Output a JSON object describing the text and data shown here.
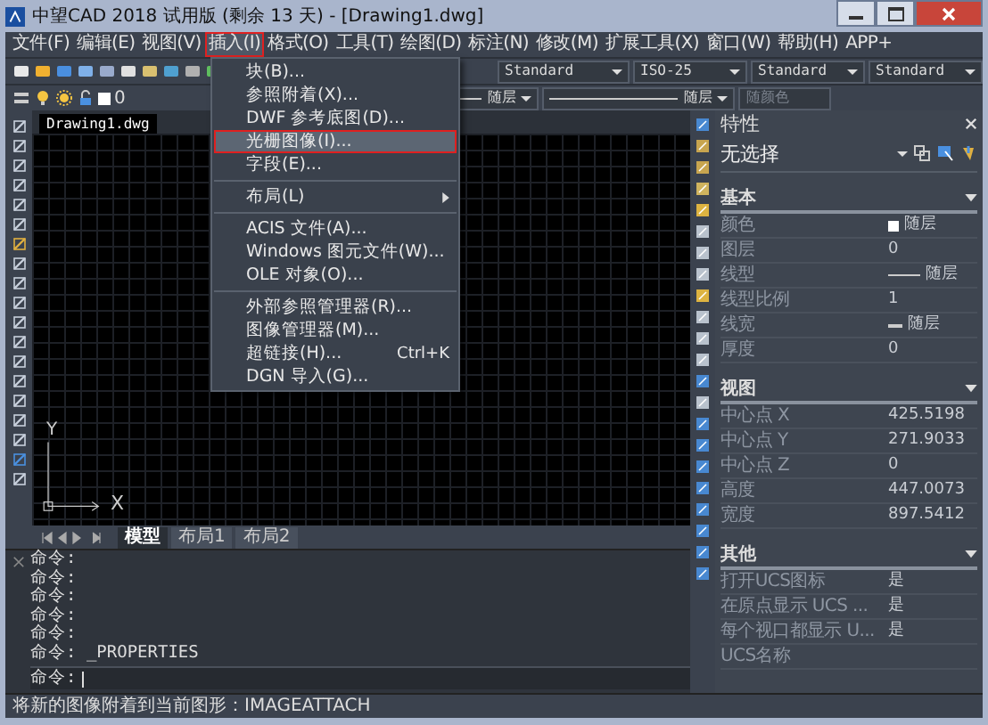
{
  "window": {
    "title": "中望CAD 2018 试用版 (剩余 13 天) - [Drawing1.dwg]"
  },
  "menu_bar": [
    {
      "label": "文件(F)",
      "selected": false
    },
    {
      "label": "编辑(E)",
      "selected": false
    },
    {
      "label": "视图(V)",
      "selected": false
    },
    {
      "label": "插入(I)",
      "selected": true
    },
    {
      "label": "格式(O)",
      "selected": false
    },
    {
      "label": "工具(T)",
      "selected": false
    },
    {
      "label": "绘图(D)",
      "selected": false
    },
    {
      "label": "标注(N)",
      "selected": false
    },
    {
      "label": "修改(M)",
      "selected": false
    },
    {
      "label": "扩展工具(X)",
      "selected": false
    },
    {
      "label": "窗口(W)",
      "selected": false
    },
    {
      "label": "帮助(H)",
      "selected": false
    },
    {
      "label": "APP+",
      "selected": false
    }
  ],
  "insert_menu": [
    {
      "label": "块(B)...",
      "selected": false,
      "submenu": false,
      "divider_after": false
    },
    {
      "label": "参照附着(X)...",
      "selected": false,
      "submenu": false,
      "divider_after": false
    },
    {
      "label": "DWF 参考底图(D)...",
      "selected": false,
      "submenu": false,
      "divider_after": false
    },
    {
      "label": "光栅图像(I)...",
      "selected": true,
      "submenu": false,
      "divider_after": false
    },
    {
      "label": "字段(E)...",
      "selected": false,
      "submenu": false,
      "divider_after": true
    },
    {
      "label": "布局(L)",
      "selected": false,
      "submenu": true,
      "divider_after": true
    },
    {
      "label": "ACIS 文件(A)...",
      "selected": false,
      "submenu": false,
      "divider_after": false
    },
    {
      "label": "Windows 图元文件(W)...",
      "selected": false,
      "submenu": false,
      "divider_after": false
    },
    {
      "label": "OLE 对象(O)...",
      "selected": false,
      "submenu": false,
      "divider_after": true
    },
    {
      "label": "外部参照管理器(R)...",
      "selected": false,
      "submenu": false,
      "divider_after": false
    },
    {
      "label": "图像管理器(M)...",
      "selected": false,
      "submenu": false,
      "divider_after": false
    },
    {
      "label": "超链接(H)...",
      "shortcut": "Ctrl+K",
      "selected": false,
      "submenu": false,
      "divider_after": false
    },
    {
      "label": "DGN 导入(G)...",
      "selected": false,
      "submenu": false,
      "divider_after": false
    }
  ],
  "toolbar": {
    "text_style": "Standard",
    "dim_style": "ISO-25",
    "table_style": "Standard",
    "multileader_style": "Standard",
    "layer": "0",
    "linetype": "随层",
    "lineweight": "随层",
    "plot_style": {
      "value": "随颜色",
      "disabled": true
    }
  },
  "document_tabs": [
    {
      "label": "Drawing1.dwg",
      "selected": true
    }
  ],
  "ucs": {
    "x": "X",
    "y": "Y"
  },
  "layout_tabs": [
    {
      "label": "模型",
      "selected": true
    },
    {
      "label": "布局1",
      "selected": false
    },
    {
      "label": "布局2",
      "selected": false
    }
  ],
  "command": {
    "history": [
      "命令:",
      "命令:",
      "命令:",
      "命令:",
      "命令:",
      "命令: _PROPERTIES"
    ],
    "prompt": "命令:"
  },
  "status_bar": {
    "text": "将新的图像附着到当前图形：IMAGEATTACH"
  },
  "properties": {
    "title": "特性",
    "selection": "无选择",
    "sections": [
      {
        "title": "基本",
        "expanded": true,
        "rows": [
          {
            "label": "颜色",
            "value": "随层",
            "kind": "color"
          },
          {
            "label": "图层",
            "value": "0",
            "kind": "text"
          },
          {
            "label": "线型",
            "value": "随层",
            "kind": "line"
          },
          {
            "label": "线型比例",
            "value": "1",
            "kind": "text"
          },
          {
            "label": "线宽",
            "value": "随层",
            "kind": "weight"
          },
          {
            "label": "厚度",
            "value": "0",
            "kind": "text"
          }
        ]
      },
      {
        "title": "视图",
        "expanded": true,
        "rows": [
          {
            "label": "中心点 X",
            "value": "425.5198",
            "kind": "text"
          },
          {
            "label": "中心点 Y",
            "value": "271.9033",
            "kind": "text"
          },
          {
            "label": "中心点 Z",
            "value": "0",
            "kind": "text"
          },
          {
            "label": "高度",
            "value": "447.0073",
            "kind": "text"
          },
          {
            "label": "宽度",
            "value": "897.5412",
            "kind": "text"
          }
        ]
      },
      {
        "title": "其他",
        "expanded": true,
        "rows": [
          {
            "label": "打开UCS图标",
            "value": "是",
            "kind": "text"
          },
          {
            "label": "在原点显示 UCS ...",
            "value": "是",
            "kind": "text"
          },
          {
            "label": "每个视口都显示 U...",
            "value": "是",
            "kind": "text"
          },
          {
            "label": "UCS名称"
          }
        ]
      }
    ]
  }
}
